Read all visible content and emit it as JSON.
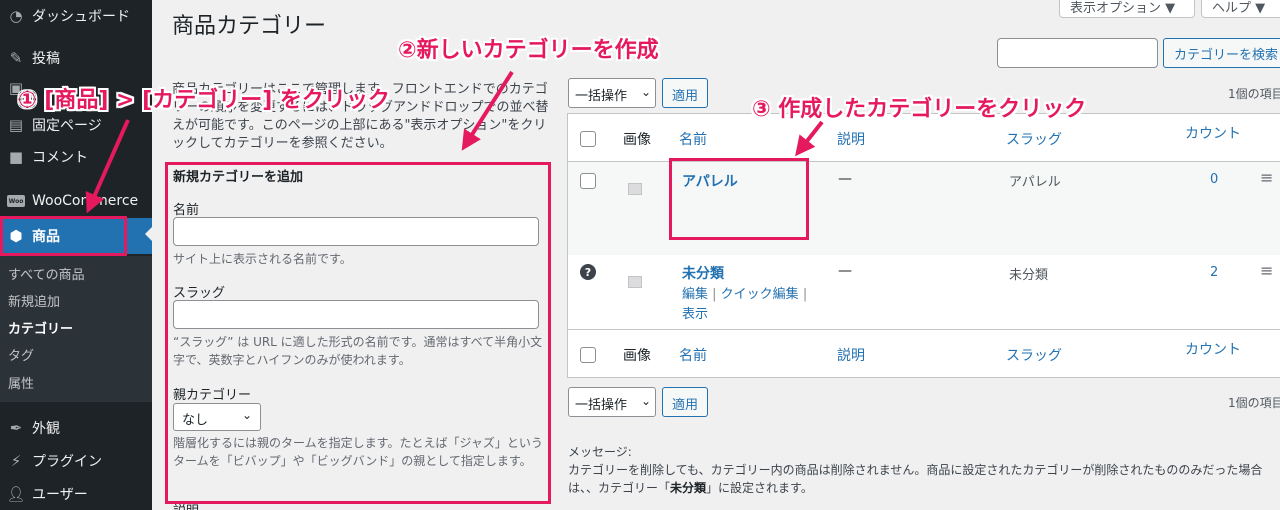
{
  "sidebar": {
    "dashboard": "ダッシュボード",
    "posts": "投稿",
    "pages": "固定ページ",
    "comments": "コメント",
    "woocommerce": "WooCommerce",
    "woo_badge": "Woo",
    "products": "商品",
    "submenu": [
      "すべての商品",
      "新規追加",
      "カテゴリー",
      "タグ",
      "属性"
    ],
    "appearance": "外観",
    "plugins": "プラグイン",
    "users": "ユーザー"
  },
  "header": {
    "title": "商品カテゴリー",
    "screen_options": "表示オプション ▼",
    "help": "ヘルプ ▼",
    "search_button": "カテゴリーを検索"
  },
  "intro": {
    "text": "商品カテゴリーはここで管理します。フロントエンドでのカテゴリーの順序を変更するには、ドラッグアンドドロップでの並べ替えが可能です。このページの上部にある\"表示オプション\"をクリックしてカテゴリーを参照ください。"
  },
  "add_form": {
    "heading": "新規カテゴリーを追加",
    "name_label": "名前",
    "name_help": "サイト上に表示される名前です。",
    "slug_label": "スラッグ",
    "slug_help": "“スラッグ” は URL に適した形式の名前です。通常はすべて半角小文字で、英数字とハイフンのみが使われます。",
    "parent_label": "親カテゴリー",
    "parent_value": "なし",
    "parent_help": "階層化するには親のタームを指定します。たとえば「ジャズ」というタームを「ビバップ」や「ビッグバンド」の親として指定します。",
    "desc_label": "説明"
  },
  "list": {
    "bulk_label": "一括操作",
    "apply_label": "適用",
    "count_text": "1個の項目",
    "headers": {
      "image": "画像",
      "name": "名前",
      "description": "説明",
      "slug": "スラッグ",
      "count": "カウント"
    },
    "rows": [
      {
        "name": "アパレル",
        "description": "—",
        "slug": "アパレル",
        "count": "0"
      },
      {
        "name": "未分類",
        "description": "—",
        "slug": "未分類",
        "count": "2"
      }
    ],
    "row_actions": {
      "edit": "編集",
      "quick_edit": "クイック編集",
      "view": "表示",
      "sep": " | "
    }
  },
  "message": {
    "title": "メッセージ:",
    "body_prefix": "カテゴリーを削除しても、カテゴリー内の商品は削除されません。商品に設定されたカテゴリーが削除されたもののみだった場合は、、カテゴリー「",
    "body_bold": "未分類",
    "body_suffix": "」に設定されます。"
  },
  "annotations": {
    "step1": "① [商品] > [カテゴリー] をクリック",
    "step2": "②新しいカテゴリーを作成",
    "step3": "③ 作成したカテゴリーをクリック",
    "color": "#e5195e"
  },
  "colors": {
    "sidebar_bg": "#1d2327",
    "accent": "#2271b1",
    "annotation": "#e5195e"
  }
}
